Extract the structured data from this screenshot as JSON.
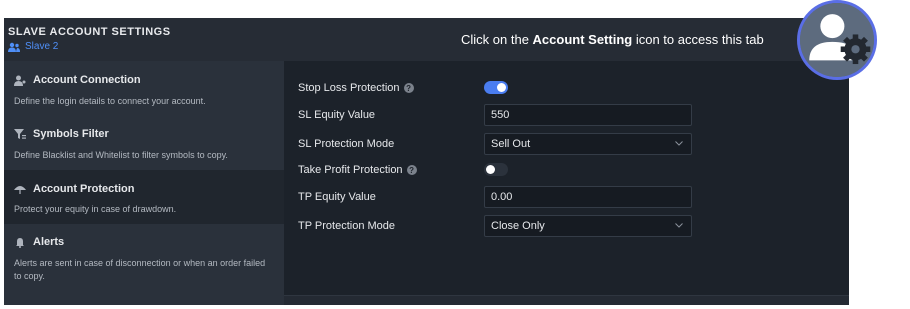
{
  "header": {
    "title": "SLAVE ACCOUNT SETTINGS",
    "account_name": "Slave 2"
  },
  "hint": {
    "prefix": "Click on the ",
    "bold": "Account Setting",
    "suffix": " icon to access this tab"
  },
  "sidebar": {
    "items": [
      {
        "title": "Account Connection",
        "desc": "Define the login details to connect your account.",
        "icon": "user-key-icon"
      },
      {
        "title": "Symbols Filter",
        "desc": "Define Blacklist and Whitelist to filter symbols to copy.",
        "icon": "filter-icon"
      },
      {
        "title": "Account Protection",
        "desc": "Protect your equity in case of drawdown.",
        "icon": "umbrella-icon"
      },
      {
        "title": "Alerts",
        "desc": "Alerts are sent in case of disconnection or when an order failed to copy.",
        "icon": "bell-icon"
      }
    ],
    "active_index": 2
  },
  "settings": {
    "stop_loss_protection": {
      "label": "Stop Loss Protection",
      "enabled": true
    },
    "sl_equity_value": {
      "label": "SL Equity Value",
      "value": "550"
    },
    "sl_protection_mode": {
      "label": "SL Protection Mode",
      "value": "Sell Out"
    },
    "take_profit_protection": {
      "label": "Take Profit Protection",
      "enabled": false
    },
    "tp_equity_value": {
      "label": "TP Equity Value",
      "value": "0.00"
    },
    "tp_protection_mode": {
      "label": "TP Protection Mode",
      "value": "Close Only"
    }
  },
  "colors": {
    "accent": "#4a7df0",
    "panel_bg": "#242a33",
    "content_bg": "#1c222a",
    "avatar_ring": "#5a6ee6"
  }
}
